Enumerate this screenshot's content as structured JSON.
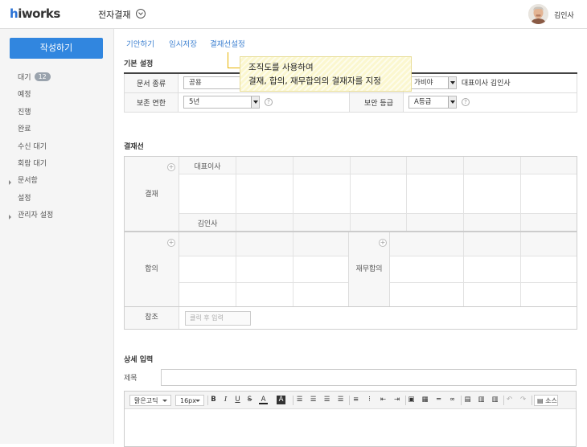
{
  "header": {
    "logo_prefix": "h",
    "logo_rest": "iworks",
    "app_title": "전자결재",
    "user_name": "김인사"
  },
  "sidebar": {
    "write_button": "작성하기",
    "items": [
      {
        "label": "대기",
        "badge": "12",
        "expandable": false
      },
      {
        "label": "예정",
        "expandable": false
      },
      {
        "label": "진행",
        "expandable": false
      },
      {
        "label": "완료",
        "expandable": false
      },
      {
        "label": "수신 대기",
        "expandable": false
      },
      {
        "label": "회람 대기",
        "expandable": false
      },
      {
        "label": "문서함",
        "expandable": true
      },
      {
        "label": "설정",
        "expandable": false
      },
      {
        "label": "관리자 설정",
        "expandable": true
      }
    ]
  },
  "tabs": [
    "기안하기",
    "임시저장",
    "결재선설정"
  ],
  "tooltip": {
    "line1": "조직도를 사용하여",
    "line2": "결재, 합의, 재무합의의 결재자를 지정"
  },
  "basic": {
    "title": "기본 설정",
    "doc_type_label": "문서 종류",
    "doc_type_value": "공용",
    "drafter_label_partial": "자",
    "drafter_value": "가비야",
    "drafter_text": "대표이사 김인사",
    "retention_label": "보존 연한",
    "retention_value": "5년",
    "security_label": "보안 등급",
    "security_value": "A등급",
    "help_glyph": "?"
  },
  "approval": {
    "title": "결재선",
    "approve_label": "결재",
    "approver_position": "대표이사",
    "approver_name": "김인사",
    "agree_label": "합의",
    "finance_label": "재무합의",
    "ref_label": "참조",
    "ref_placeholder": "클릭 후 입력",
    "plus_glyph": "+"
  },
  "detail": {
    "title": "상세 입력",
    "subject_label": "제목",
    "font_family": "맑은고딕",
    "font_size": "16px",
    "source_label": "소스"
  }
}
